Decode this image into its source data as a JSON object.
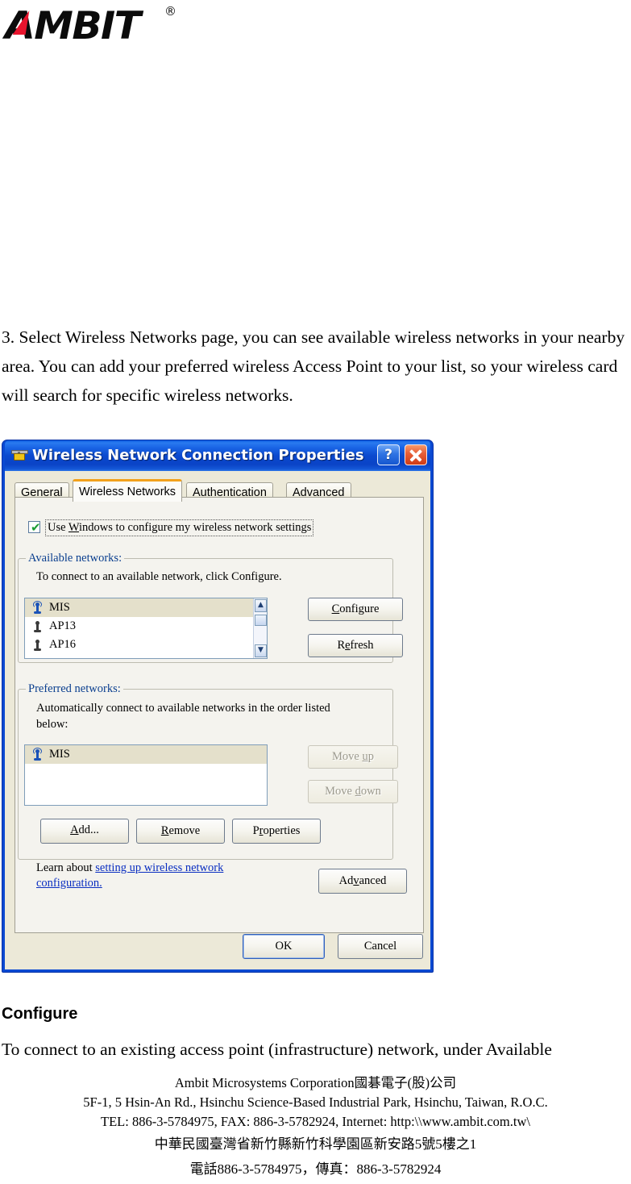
{
  "logo": {
    "text": "AMBIT",
    "registered_mark": "®",
    "icon": "ambit-logo"
  },
  "document": {
    "step3_paragraph": "3. Select Wireless Networks page, you can see available wireless networks in your nearby area. You can add your preferred wireless Access Point to your list, so your wireless card will search for specific wireless networks.",
    "configure_heading": "Configure",
    "configure_paragraph": "To connect to an existing access point (infrastructure) network, under Available"
  },
  "dialog": {
    "title": "Wireless Network Connection Properties",
    "help_button": "?",
    "close_button": "×",
    "tabs": [
      {
        "label": "General",
        "active": false
      },
      {
        "label": "Wireless Networks",
        "active": true
      },
      {
        "label": "Authentication",
        "active": false
      },
      {
        "label": "Advanced",
        "active": false
      }
    ],
    "use_windows_checkbox": {
      "label_before": "Use ",
      "label_accel": "W",
      "label_after": "indows to configure my wireless network settings",
      "checked": true
    },
    "available_networks": {
      "legend": "Available networks:",
      "description": "To connect to an available network, click Configure.",
      "items": [
        {
          "name": "MIS",
          "selected": true,
          "icon": "wireless-active-icon"
        },
        {
          "name": "AP13",
          "selected": false,
          "icon": "wireless-icon"
        },
        {
          "name": "AP16",
          "selected": false,
          "icon": "wireless-icon"
        }
      ],
      "configure_button": "Configure",
      "refresh_button": "Refresh"
    },
    "preferred_networks": {
      "legend": "Preferred networks:",
      "description_line1": "Automatically connect to available networks in the order listed",
      "description_line2": "below:",
      "items": [
        {
          "name": "MIS",
          "selected": true,
          "icon": "wireless-active-icon"
        }
      ],
      "move_up_button": "Move up",
      "move_down_button": "Move down",
      "move_up_enabled": false,
      "move_down_enabled": false,
      "add_button": "Add...",
      "remove_button": "Remove",
      "properties_button": "Properties"
    },
    "learn_about": {
      "prefix": "Learn about ",
      "link": "setting up wireless network configuration."
    },
    "advanced_button": "Advanced",
    "ok_button": "OK",
    "cancel_button": "Cancel"
  },
  "footer": {
    "line1": "Ambit Microsystems Corporation國碁電子(股)公司",
    "line2": "5F-1, 5 Hsin-An Rd., Hsinchu Science-Based Industrial Park, Hsinchu, Taiwan, R.O.C.",
    "line3": "TEL: 886-3-5784975, FAX: 886-3-5782924, Internet: http:\\\\www.ambit.com.tw\\",
    "line4": "中華民國臺灣省新竹縣新竹科學園區新安路5號5樓之1",
    "line5": "電話886-3-5784975，傳真：886-3-5782924"
  },
  "colors": {
    "titlebar_blue": "#0a49d2",
    "dialog_face": "#ece9d8",
    "tab_active_accent": "#f2a11c",
    "link_blue": "#0a2ec1",
    "selection": "#e4e0cb",
    "logo_red": "#e8142d"
  }
}
